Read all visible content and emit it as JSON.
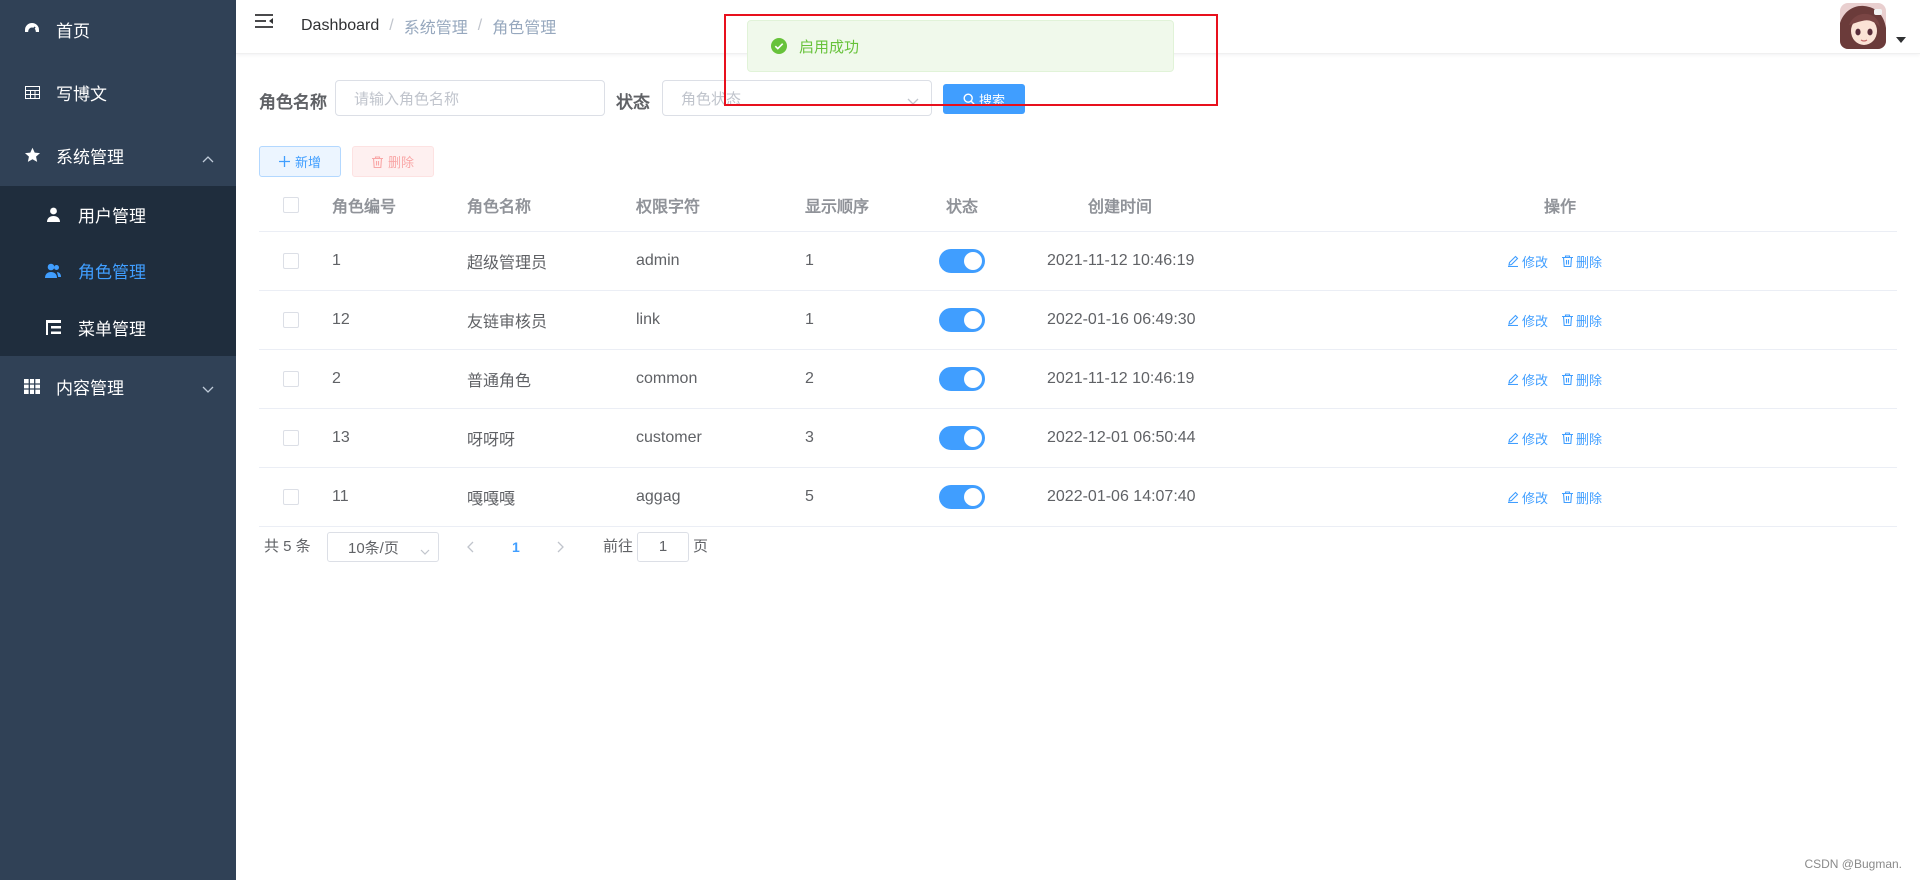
{
  "colors": {
    "sidebar_bg": "#304156",
    "submenu_bg": "#1f2d3d",
    "primary": "#409eff",
    "success": "#67c23a",
    "danger": "#f56c6c",
    "highlight": "#e8101d"
  },
  "sidebar": {
    "items": [
      {
        "label": "首页",
        "icon": "dashboard-icon"
      },
      {
        "label": "写博文",
        "icon": "table-icon"
      },
      {
        "label": "系统管理",
        "icon": "star-icon",
        "expanded": true,
        "children": [
          {
            "label": "用户管理",
            "icon": "user-icon"
          },
          {
            "label": "角色管理",
            "icon": "peoples-icon",
            "active": true
          },
          {
            "label": "菜单管理",
            "icon": "tree-table-icon"
          }
        ]
      },
      {
        "label": "内容管理",
        "icon": "grid-icon",
        "expanded": false
      }
    ]
  },
  "navbar": {
    "breadcrumb": [
      "Dashboard",
      "系统管理",
      "角色管理"
    ],
    "separator": "/"
  },
  "search": {
    "role_name_label": "角色名称",
    "role_name_placeholder": "请输入角色名称",
    "status_label": "状态",
    "status_placeholder": "角色状态",
    "search_button": "搜索"
  },
  "toolbar": {
    "add_button": "新增",
    "delete_button": "删除"
  },
  "table": {
    "headers": [
      "角色编号",
      "角色名称",
      "权限字符",
      "显示顺序",
      "状态",
      "创建时间",
      "操作"
    ],
    "rows": [
      {
        "id": "1",
        "name": "超级管理员",
        "key": "admin",
        "sort": "1",
        "enabled": true,
        "created": "2021-11-12 10:46:19"
      },
      {
        "id": "12",
        "name": "友链审核员",
        "key": "link",
        "sort": "1",
        "enabled": true,
        "created": "2022-01-16 06:49:30"
      },
      {
        "id": "2",
        "name": "普通角色",
        "key": "common",
        "sort": "2",
        "enabled": true,
        "created": "2021-11-12 10:46:19"
      },
      {
        "id": "13",
        "name": "呀呀呀",
        "key": "customer",
        "sort": "3",
        "enabled": true,
        "created": "2022-12-01 06:50:44"
      },
      {
        "id": "11",
        "name": "嘎嘎嘎",
        "key": "aggag",
        "sort": "5",
        "enabled": true,
        "created": "2022-01-06 14:07:40"
      }
    ],
    "edit_label": "修改",
    "delete_label": "删除"
  },
  "pagination": {
    "total_text": "共 5 条",
    "page_size": "10条/页",
    "current_page": "1",
    "goto_label": "前往",
    "goto_value": "1",
    "page_unit": "页"
  },
  "message": {
    "text": "启用成功",
    "type": "success"
  },
  "watermark": "CSDN @Bugman."
}
